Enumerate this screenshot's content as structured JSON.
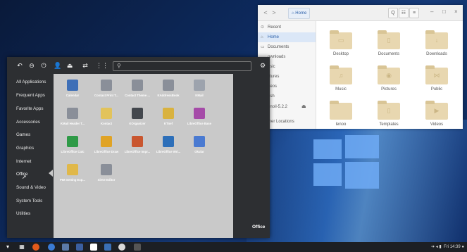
{
  "file_manager": {
    "location": "Home",
    "nav": {
      "back": "<",
      "forward": ">"
    },
    "tools": {
      "search": "Q",
      "view": "☷",
      "menu": "≡"
    },
    "window_controls": {
      "minimize": "–",
      "maximize": "□",
      "close": "×"
    },
    "sidebar": [
      {
        "icon": "⊙",
        "label": "Recent"
      },
      {
        "icon": "⌂",
        "label": "Home"
      },
      {
        "icon": "▭",
        "label": "Documents"
      },
      {
        "icon": "",
        "label": "ownloads"
      },
      {
        "icon": "",
        "label": "usic"
      },
      {
        "icon": "",
        "label": "ctures"
      },
      {
        "icon": "",
        "label": "deos"
      },
      {
        "icon": "",
        "label": "ash"
      },
      {
        "icon": "",
        "label": "enoil-5.2.2"
      },
      {
        "icon": "",
        "label": "ther Locations"
      }
    ],
    "eject_icon": "⏏",
    "folders": [
      {
        "name": "Desktop",
        "emblem": "▭"
      },
      {
        "name": "Documents",
        "emblem": "▯"
      },
      {
        "name": "Downloads",
        "emblem": "↓"
      },
      {
        "name": "Music",
        "emblem": "♫"
      },
      {
        "name": "Pictures",
        "emblem": "◉"
      },
      {
        "name": "Public",
        "emblem": "⋈"
      },
      {
        "name": "lenoo",
        "emblem": ""
      },
      {
        "name": "Templates",
        "emblem": "▯"
      },
      {
        "name": "Videos",
        "emblem": "▶"
      }
    ]
  },
  "menu": {
    "top_icons": [
      "↶",
      "⊖",
      "⏻",
      "👤",
      "⏏",
      "⇄",
      "⋮⋮"
    ],
    "search_icon": "⚲",
    "settings_icon": "⚙",
    "categories": [
      "All Applications",
      "Frequent Apps",
      "Favorite Apps",
      "Accessories",
      "Games",
      "Graphics",
      "Internet",
      "Office",
      "Sound & Video",
      "System Tools",
      "Utilities"
    ],
    "selected_category": "Office",
    "apps": [
      {
        "label": "Calendar",
        "color": "#3e6fb7"
      },
      {
        "label": "Contact Print T...",
        "color": "#8a8f99"
      },
      {
        "label": "Contact Theme ...",
        "color": "#8a8f99"
      },
      {
        "label": "KAddressBook",
        "color": "#8a8f99"
      },
      {
        "label": "KMail",
        "color": "#9da3ad"
      },
      {
        "label": "KMail Header T...",
        "color": "#8a8f99"
      },
      {
        "label": "Kontact",
        "color": "#e2c35b"
      },
      {
        "label": "KOrganizer",
        "color": "#43474d"
      },
      {
        "label": "KTnef",
        "color": "#d9b23f"
      },
      {
        "label": "LibreOffice Base",
        "color": "#a54ba8"
      },
      {
        "label": "LibreOffice Calc",
        "color": "#2f9a47"
      },
      {
        "label": "LibreOffice Draw",
        "color": "#e0a325"
      },
      {
        "label": "LibreOffice Impr...",
        "color": "#c9562f"
      },
      {
        "label": "LibreOffice Wri...",
        "color": "#2d6fb9"
      },
      {
        "label": "Okular",
        "color": "#4a7ad1"
      },
      {
        "label": "PIM Setting Exp...",
        "color": "#e0b84a"
      },
      {
        "label": "Sieve Editor",
        "color": "#8a8f99"
      }
    ],
    "footer_label": "Office"
  },
  "taskbar": {
    "icons": [
      "▾",
      "▦",
      "◉",
      "◐",
      "▭",
      "◈",
      "◘",
      "▣",
      "◍",
      "▢"
    ],
    "tray": "➔ ◂ ▮",
    "clock": "Fri 14:39 ●"
  }
}
